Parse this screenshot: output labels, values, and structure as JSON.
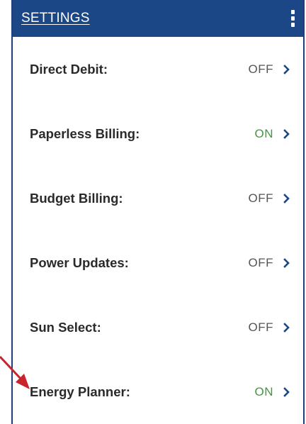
{
  "header": {
    "title": "SETTINGS",
    "menu_icon": "kebab-menu-icon"
  },
  "settings": [
    {
      "label": "Direct Debit:",
      "value": "OFF",
      "state": "off"
    },
    {
      "label": "Paperless Billing:",
      "value": "ON",
      "state": "on"
    },
    {
      "label": "Budget Billing:",
      "value": "OFF",
      "state": "off"
    },
    {
      "label": "Power Updates:",
      "value": "OFF",
      "state": "off"
    },
    {
      "label": "Sun Select:",
      "value": "OFF",
      "state": "off"
    },
    {
      "label": "Energy Planner:",
      "value": "ON",
      "state": "on"
    }
  ],
  "colors": {
    "header_bg": "#1b4786",
    "on": "#3f9a3b",
    "off": "#555555",
    "chevron": "#1b4786",
    "annotation_arrow": "#c8242b"
  },
  "annotation": {
    "icon": "red-arrow-icon",
    "points_to": "Energy Planner:"
  }
}
